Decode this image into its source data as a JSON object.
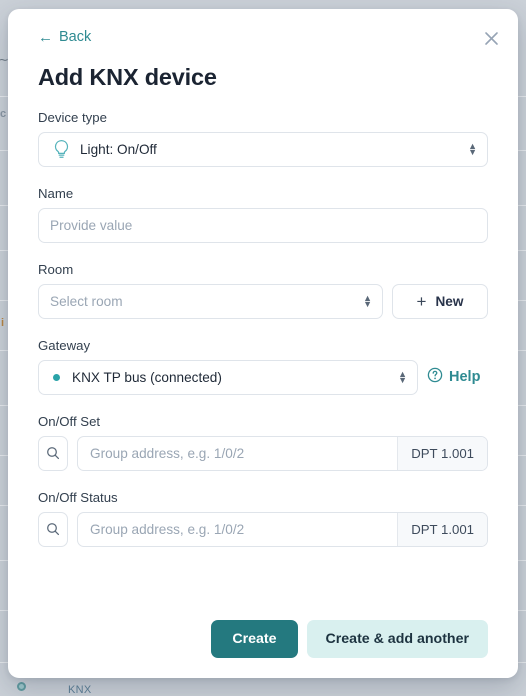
{
  "modal": {
    "back_label": "Back",
    "title": "Add KNX device",
    "close_icon": "close-icon"
  },
  "fields": {
    "device_type": {
      "label": "Device type",
      "value": "Light: On/Off",
      "icon": "light-bulb-icon"
    },
    "name": {
      "label": "Name",
      "value": "",
      "placeholder": "Provide value"
    },
    "room": {
      "label": "Room",
      "value": "",
      "placeholder": "Select room",
      "new_button": "New",
      "new_icon": "plus-icon"
    },
    "gateway": {
      "label": "Gateway",
      "value": "KNX TP bus (connected)",
      "status_color": "#2aa3a8",
      "help_label": "Help",
      "help_icon": "question-circle-icon"
    },
    "onoff_set": {
      "label": "On/Off Set",
      "search_icon": "search-icon",
      "value": "",
      "placeholder": "Group address, e.g. 1/0/2",
      "dpt": "DPT 1.001"
    },
    "onoff_status": {
      "label": "On/Off Status",
      "search_icon": "search-icon",
      "value": "",
      "placeholder": "Group address, e.g. 1/0/2",
      "dpt": "DPT 1.001"
    }
  },
  "footer": {
    "create_label": "Create",
    "create_add_another_label": "Create & add another"
  },
  "background": {
    "knx_label": "KNX",
    "fragment_left_1": "c",
    "fragment_left_2": "i"
  },
  "colors": {
    "accent_teal": "#2f8b92",
    "primary_button": "#24797f",
    "secondary_button": "#d9f0ef",
    "title_text": "#1b2432",
    "border": "#dfe4ea",
    "placeholder": "#9aa6b4",
    "backdrop": "#cbd1d8"
  }
}
